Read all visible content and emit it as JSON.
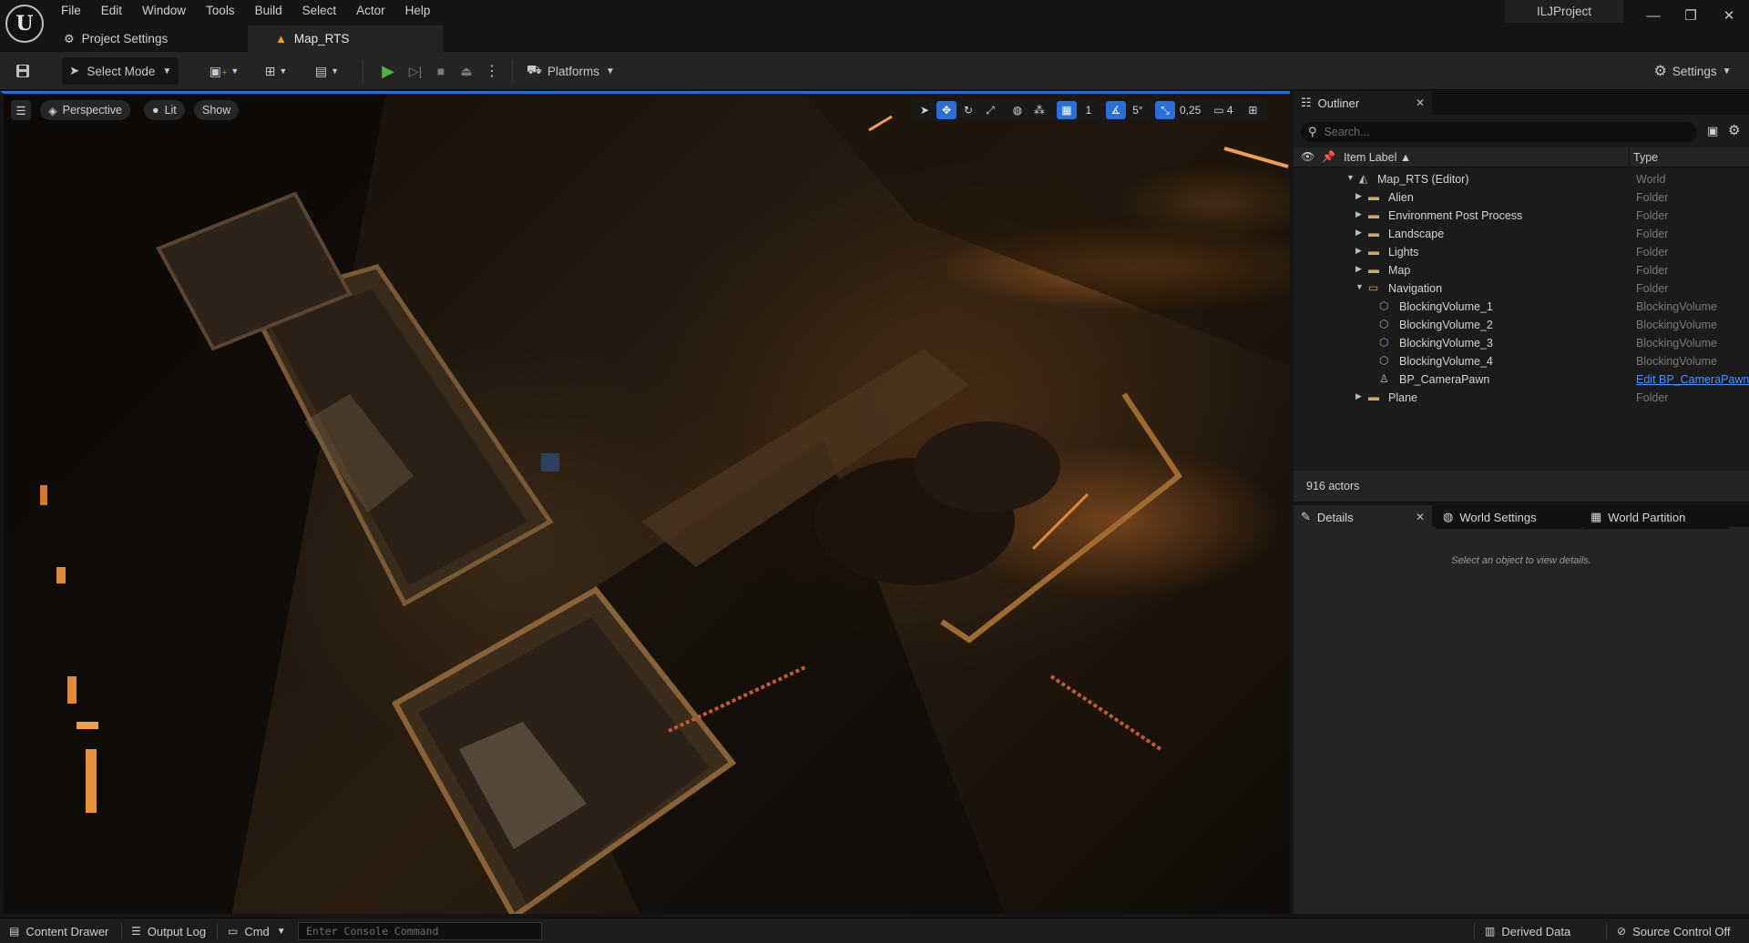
{
  "menu": [
    "File",
    "Edit",
    "Window",
    "Tools",
    "Build",
    "Select",
    "Actor",
    "Help"
  ],
  "tabs": [
    {
      "label": "Project Settings",
      "icon": "gear-icon"
    },
    {
      "label": "Map_RTS",
      "icon": "map-level-icon"
    }
  ],
  "project_name": "ILJProject",
  "toolbar": {
    "select_mode_label": "Select Mode",
    "platforms_label": "Platforms",
    "settings_label": "Settings"
  },
  "viewport": {
    "perspective_label": "Perspective",
    "lit_label": "Lit",
    "show_label": "Show",
    "grid_snap_value": "1",
    "rotation_snap_value": "5°",
    "scale_snap_value": "0,25",
    "camera_speed_value": "4"
  },
  "outliner": {
    "tab_label": "Outliner",
    "search_placeholder": "Search...",
    "col_label": "Item Label ▲",
    "col_type": "Type",
    "rows": [
      {
        "label": "Map_RTS (Editor)",
        "type": "World",
        "icon": "world-icon",
        "expand": "open"
      },
      {
        "label": "Alien",
        "type": "Folder",
        "icon": "folder-icon",
        "expand": "closed"
      },
      {
        "label": "Environment Post Process",
        "type": "Folder",
        "icon": "folder-icon",
        "expand": "closed"
      },
      {
        "label": "Landscape",
        "type": "Folder",
        "icon": "folder-icon",
        "expand": "closed"
      },
      {
        "label": "Lights",
        "type": "Folder",
        "icon": "folder-icon",
        "expand": "closed"
      },
      {
        "label": "Map",
        "type": "Folder",
        "icon": "folder-icon",
        "expand": "closed"
      },
      {
        "label": "Navigation",
        "type": "Folder",
        "icon": "folder-open-icon",
        "expand": "open"
      },
      {
        "label": "BlockingVolume_1",
        "type": "BlockingVolume",
        "icon": "blocking-volume-icon",
        "expand": "none"
      },
      {
        "label": "BlockingVolume_2",
        "type": "BlockingVolume",
        "icon": "blocking-volume-icon",
        "expand": "none"
      },
      {
        "label": "BlockingVolume_3",
        "type": "BlockingVolume",
        "icon": "blocking-volume-icon",
        "expand": "none"
      },
      {
        "label": "BlockingVolume_4",
        "type": "BlockingVolume",
        "icon": "blocking-volume-icon",
        "expand": "none"
      },
      {
        "label": "BP_CameraPawn",
        "type": "Edit BP_CameraPawn",
        "icon": "pawn-icon",
        "expand": "none",
        "link": true
      },
      {
        "label": "Plane",
        "type": "Folder",
        "icon": "folder-icon",
        "expand": "closed"
      }
    ],
    "actor_count": "916 actors"
  },
  "details": {
    "tab_label": "Details",
    "world_settings_label": "World Settings",
    "world_partition_label": "World Partition",
    "empty_message": "Select an object to view details."
  },
  "statusbar": {
    "content_drawer": "Content Drawer",
    "output_log": "Output Log",
    "cmd": "Cmd",
    "console_placeholder": "Enter Console Command",
    "derived_data": "Derived Data",
    "source_control": "Source Control Off"
  },
  "colors": {
    "accent": "#2a6fd6",
    "play_green": "#4bb543",
    "link_blue": "#4a94ff",
    "folder": "#c9a766"
  }
}
